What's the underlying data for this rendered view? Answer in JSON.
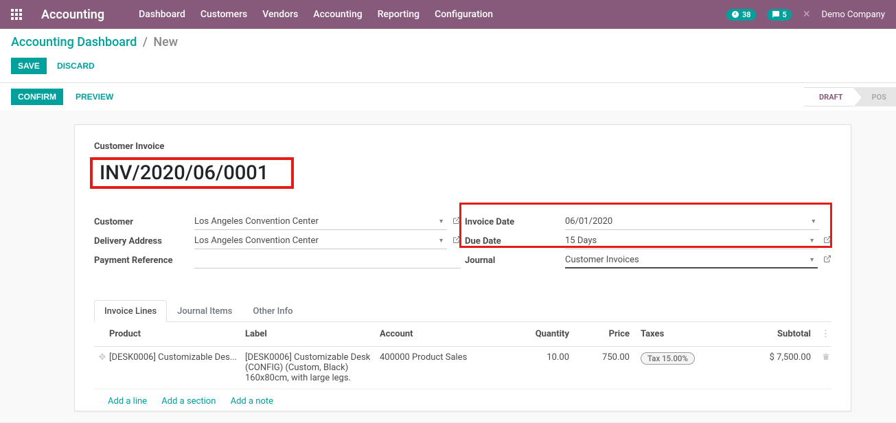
{
  "topbar": {
    "app_name": "Accounting",
    "menu": [
      "Dashboard",
      "Customers",
      "Vendors",
      "Accounting",
      "Reporting",
      "Configuration"
    ],
    "badge1": "38",
    "badge2": "5",
    "company": "Demo Company"
  },
  "breadcrumb": {
    "root": "Accounting Dashboard",
    "current": "New"
  },
  "buttons": {
    "save": "SAVE",
    "discard": "DISCARD",
    "confirm": "CONFIRM",
    "preview": "PREVIEW"
  },
  "status": {
    "draft": "DRAFT",
    "posted": "POS"
  },
  "invoice": {
    "title_label": "Customer Invoice",
    "number": "INV/2020/06/0001",
    "left": {
      "customer_label": "Customer",
      "customer": "Los Angeles Convention Center",
      "delivery_label": "Delivery Address",
      "delivery": "Los Angeles Convention Center",
      "payment_ref_label": "Payment Reference",
      "payment_ref": ""
    },
    "right": {
      "invoice_date_label": "Invoice Date",
      "invoice_date": "06/01/2020",
      "due_date_label": "Due Date",
      "due_date": "15 Days",
      "journal_label": "Journal",
      "journal": "Customer Invoices"
    }
  },
  "tabs": [
    "Invoice Lines",
    "Journal Items",
    "Other Info"
  ],
  "table": {
    "headers": {
      "product": "Product",
      "label": "Label",
      "account": "Account",
      "quantity": "Quantity",
      "price": "Price",
      "taxes": "Taxes",
      "subtotal": "Subtotal"
    },
    "rows": [
      {
        "product": "[DESK0006] Customizable Des...",
        "label": "[DESK0006] Customizable Desk (CONFIG) (Custom, Black) 160x80cm, with large legs.",
        "account": "400000 Product Sales",
        "quantity": "10.00",
        "price": "750.00",
        "taxes": "Tax 15.00%",
        "subtotal": "$ 7,500.00"
      }
    ],
    "add_line": "Add a line",
    "add_section": "Add a section",
    "add_note": "Add a note"
  }
}
